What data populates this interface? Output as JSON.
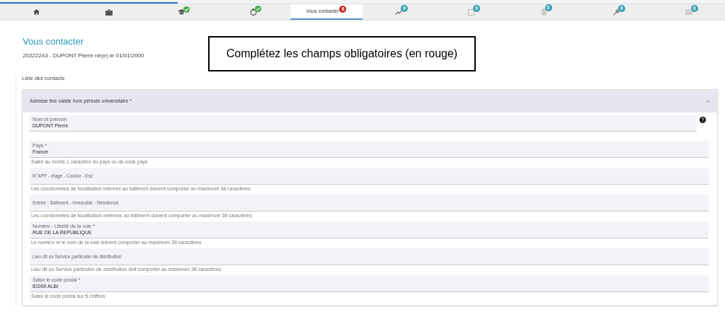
{
  "progress": {
    "level": 0.245
  },
  "tabs": [
    {
      "selected": false
    },
    {
      "selected": false
    },
    {
      "selected": false,
      "kind": "check",
      "color": "#4caf50"
    },
    {
      "selected": false,
      "kind": "check",
      "color": "#4caf50"
    },
    {
      "selected": true,
      "label": "Vous contacter",
      "badge": "6",
      "kind": "count",
      "color": "#c62828"
    },
    {
      "selected": false,
      "badge": "0",
      "kind": "count",
      "color": "#3aa0b0"
    },
    {
      "selected": false,
      "badge": "0",
      "kind": "count",
      "color": "#3aa0b0"
    },
    {
      "selected": false,
      "badge": "0",
      "kind": "count",
      "color": "#3aa0b0"
    },
    {
      "selected": false,
      "badge": "0",
      "kind": "count",
      "color": "#3aa0b0"
    },
    {
      "selected": false,
      "badge": "0",
      "kind": "count",
      "color": "#3aa0b0"
    }
  ],
  "page_title": "Vous contacter",
  "student": "20222243 - DUPONT Pierre né(e) le 01/01/2000",
  "callout": "Complétez les champs obligatoires (en rouge)",
  "section_title": "Liste des contacts",
  "panel": {
    "title": "Adresse fixe valide hors période universitaire *",
    "expanded": true,
    "fields": [
      {
        "label": "Nom et prénom",
        "value": "DUPONT Pierre",
        "help": true
      },
      {
        "label": "Pays *",
        "value": "France",
        "hint": "Saisir au moins 1 caractère du pays ou du code pays"
      },
      {
        "placeholder": "N°APP - étage - Couloir - Esc",
        "hint": "Les coordonnées de localisation internes au bâtiment doivent comporter au maximum 38 caractères"
      },
      {
        "placeholder": "Entrée - Bâtiment - Immeuble - Résidence",
        "hint": "Les coordonnées de localisation externes au bâtiment doivent comporter au maximum 38 caractères"
      },
      {
        "label": "Numéro - Libellé de la voie *",
        "value": "RUE DE LA REPUBLIQUE",
        "hint": "Le numéro et le nom de la voie doivent comporter au maximum 38 caractères"
      },
      {
        "placeholder": "Lieu dit ou Service particulier de distribution",
        "hint": "Lieu dit ou Service particulier de distribution doit comporter au maximum 38 caractères"
      },
      {
        "label": "Saisir le code postal *",
        "value": "81000 ALBI",
        "hint": "Saisir le code postal sur 5 chiffres"
      }
    ]
  }
}
